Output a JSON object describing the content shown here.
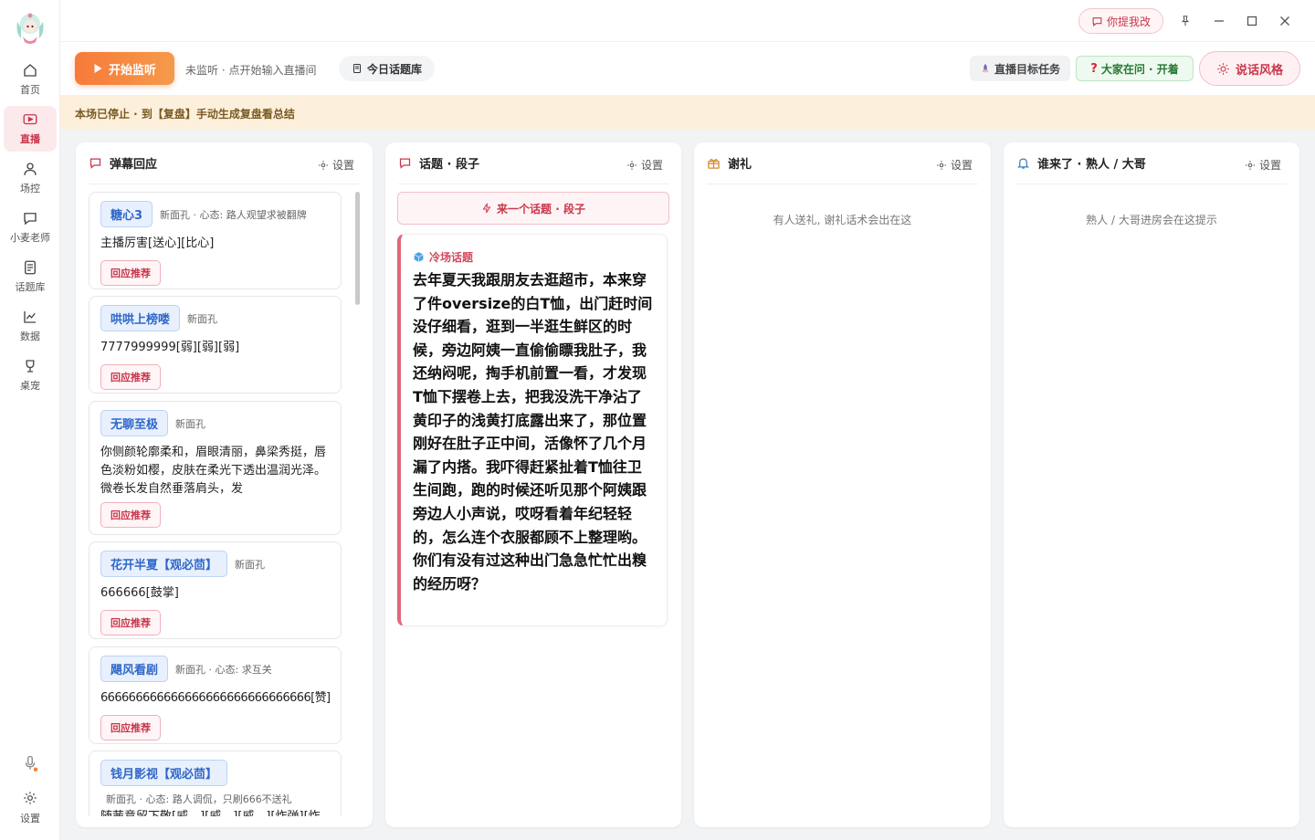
{
  "sidebar": {
    "items": [
      {
        "label": "首页"
      },
      {
        "label": "直播"
      },
      {
        "label": "场控"
      },
      {
        "label": "小麦老师"
      },
      {
        "label": "话题库"
      },
      {
        "label": "数据"
      },
      {
        "label": "桌宠"
      }
    ],
    "settings_label": "设置"
  },
  "topbar": {
    "feedback_label": "你提我改"
  },
  "toolbar": {
    "start_label": "开始监听",
    "status_text": "未监听 · 点开始输入直播间",
    "topic_library_label": "今日话题库",
    "goal_label": "直播目标任务",
    "ask_label": "大家在问 · 开着",
    "style_label": "说话风格"
  },
  "banner": {
    "text": "本场已停止 · 到【复盘】手动生成复盘看总结"
  },
  "panels": {
    "danmu": {
      "title": "弹幕回应",
      "settings_label": "设置",
      "reply_label": "回应推荐",
      "cards": [
        {
          "name": "糖心3",
          "meta": "新面孔 · 心态: 路人观望求被翻牌",
          "text": "主播厉害[送心][比心]"
        },
        {
          "name": "哄哄上榜喽",
          "meta": "新面孔",
          "text": "7777999999[弱][弱][弱]"
        },
        {
          "name": "无聊至极",
          "meta": "新面孔",
          "text": "你侧颜轮廓柔和，眉眼清丽，鼻梁秀挺，唇色淡粉如樱，皮肤在柔光下透出温润光泽。微卷长发自然垂落肩头，发"
        },
        {
          "name": "花开半夏【观必茴】",
          "meta": "新面孔",
          "text": "666666[鼓掌]"
        },
        {
          "name": "飓风看剧",
          "meta": "新面孔 · 心态: 求互关",
          "text": "666666666666666666666666666666[赞]"
        },
        {
          "name": "钱月影视【观必茴】",
          "meta": "新面孔 · 心态: 路人调侃，只刷666不送礼",
          "text": "随茜意留下敬[威…][威…][威…][炸弹][炸"
        }
      ]
    },
    "topic": {
      "title": "话题 · 段子",
      "settings_label": "设置",
      "generate_label": "来一个话题 · 段子",
      "tag": "冷场话题",
      "text": "去年夏天我跟朋友去逛超市，本来穿了件oversize的白T恤，出门赶时间没仔细看，逛到一半逛生鲜区的时候，旁边阿姨一直偷偷瞟我肚子，我还纳闷呢，掏手机前置一看，才发现T恤下摆卷上去，把我没洗干净沾了黄印子的浅黄打底露出来了，那位置刚好在肚子正中间，活像怀了几个月漏了内搭。我吓得赶紧扯着T恤往卫生间跑，跑的时候还听见那个阿姨跟旁边人小声说，哎呀看着年纪轻轻的，怎么连个衣服都顾不上整理哟。你们有没有过这种出门急急忙忙出糗的经历呀？"
    },
    "gift": {
      "title": "谢礼",
      "settings_label": "设置",
      "empty_text": "有人送礼, 谢礼话术会出在这"
    },
    "visitor": {
      "title": "谁来了 · 熟人 / 大哥",
      "settings_label": "设置",
      "empty_text": "熟人 / 大哥进房会在这提示"
    }
  },
  "colors": {
    "accent": "#c8364b",
    "start": "#f77a3a",
    "banner_bg": "#fcf0dc",
    "tag_blue": "#2f67c8"
  },
  "icons": [
    "home-icon",
    "live-icon",
    "user-icon",
    "chat-icon",
    "list-icon",
    "chart-icon",
    "trophy-icon",
    "mic-icon",
    "gear-icon",
    "pin-icon",
    "minimize-icon",
    "maximize-icon",
    "close-icon",
    "play-icon",
    "book-icon",
    "rocket-icon",
    "question-icon",
    "sun-icon",
    "gift-icon",
    "bell-icon",
    "bolt-icon",
    "cube-icon"
  ]
}
